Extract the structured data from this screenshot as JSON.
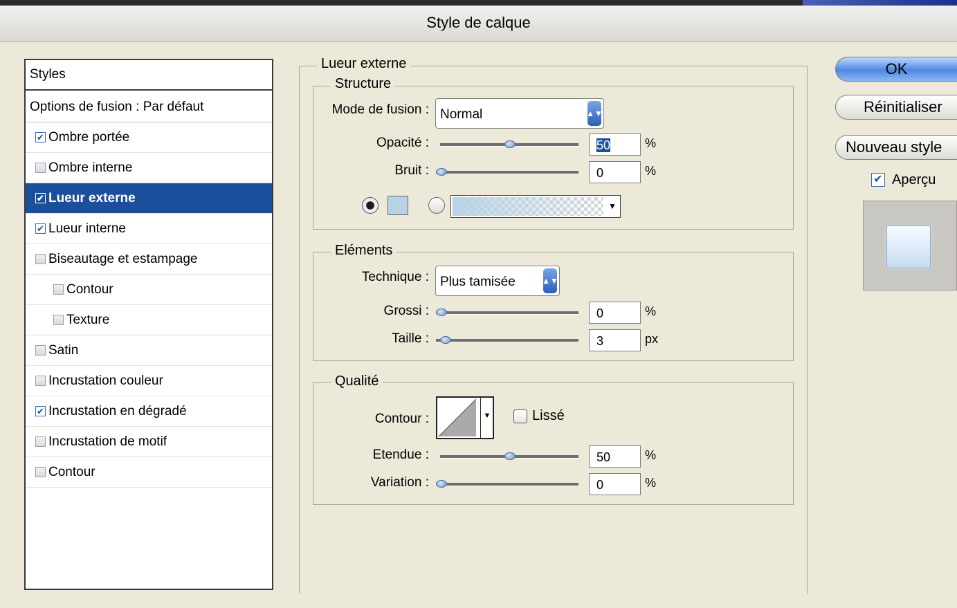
{
  "window": {
    "title": "Style de calque"
  },
  "styles_panel": {
    "header": "Styles",
    "blend_options": "Options de fusion : Par défaut",
    "items": [
      {
        "label": "Ombre portée",
        "checked": true,
        "selected": false,
        "indent": false
      },
      {
        "label": "Ombre interne",
        "checked": false,
        "selected": false,
        "indent": false
      },
      {
        "label": "Lueur externe",
        "checked": true,
        "selected": true,
        "indent": false
      },
      {
        "label": "Lueur interne",
        "checked": true,
        "selected": false,
        "indent": false
      },
      {
        "label": "Biseautage et estampage",
        "checked": false,
        "selected": false,
        "indent": false
      },
      {
        "label": "Contour",
        "checked": false,
        "selected": false,
        "indent": true
      },
      {
        "label": "Texture",
        "checked": false,
        "selected": false,
        "indent": true
      },
      {
        "label": "Satin",
        "checked": false,
        "selected": false,
        "indent": false
      },
      {
        "label": "Incrustation couleur",
        "checked": false,
        "selected": false,
        "indent": false
      },
      {
        "label": "Incrustation en dégradé",
        "checked": true,
        "selected": false,
        "indent": false
      },
      {
        "label": "Incrustation de motif",
        "checked": false,
        "selected": false,
        "indent": false
      },
      {
        "label": "Contour",
        "checked": false,
        "selected": false,
        "indent": false
      }
    ]
  },
  "outer_glow": {
    "title": "Lueur externe",
    "structure": {
      "title": "Structure",
      "blend_mode_label": "Mode de fusion :",
      "blend_mode_value": "Normal",
      "opacity_label": "Opacité :",
      "opacity_value": "50",
      "opacity_fraction": 0.5,
      "noise_label": "Bruit :",
      "noise_value": "0",
      "noise_fraction": 0,
      "percent": "%",
      "color_mode": "solid",
      "glow_color": "#b7d2e6"
    },
    "elements": {
      "title": "Eléments",
      "technique_label": "Technique :",
      "technique_value": "Plus tamisée",
      "spread_label": "Grossi :",
      "spread_value": "0",
      "spread_fraction": 0,
      "size_label": "Taille :",
      "size_value": "3",
      "size_fraction": 0.03,
      "percent": "%",
      "px": "px"
    },
    "quality": {
      "title": "Qualité",
      "contour_label": "Contour :",
      "smooth_label": "Lissé",
      "smooth_checked": false,
      "range_label": "Etendue :",
      "range_value": "50",
      "range_fraction": 0.5,
      "jitter_label": "Variation :",
      "jitter_value": "0",
      "jitter_fraction": 0,
      "percent": "%"
    }
  },
  "buttons": {
    "ok": "OK",
    "reset": "Réinitialiser",
    "new_style": "Nouveau style"
  },
  "preview": {
    "label": "Aperçu",
    "checked": true
  },
  "colors": {
    "selection": "#1b4f9c",
    "dialog": "#ECE9D8"
  }
}
